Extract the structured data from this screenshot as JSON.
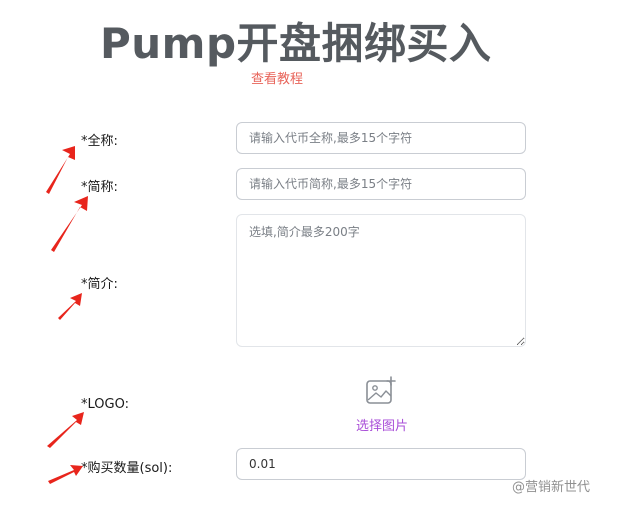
{
  "header": {
    "title": "Pump开盘捆绑买入",
    "tutorial_link": "查看教程"
  },
  "form": {
    "full_name": {
      "label": "*全称:",
      "placeholder": "请输入代币全称,最多15个字符",
      "value": ""
    },
    "short_name": {
      "label": "*简称:",
      "placeholder": "请输入代币简称,最多15个字符",
      "value": ""
    },
    "intro": {
      "label": "*简介:",
      "placeholder": "选填,简介最多200字",
      "value": ""
    },
    "logo": {
      "label": "*LOGO:",
      "upload_text": "选择图片",
      "icon": "image-add-icon"
    },
    "buy_amount": {
      "label": "*购买数量(sol):",
      "value": "0.01"
    }
  },
  "watermark": "@营销新世代",
  "colors": {
    "title": "#555a5f",
    "link": "#e8645a",
    "upload_text": "#a94fd8",
    "annotation_arrow": "#e8251c"
  }
}
